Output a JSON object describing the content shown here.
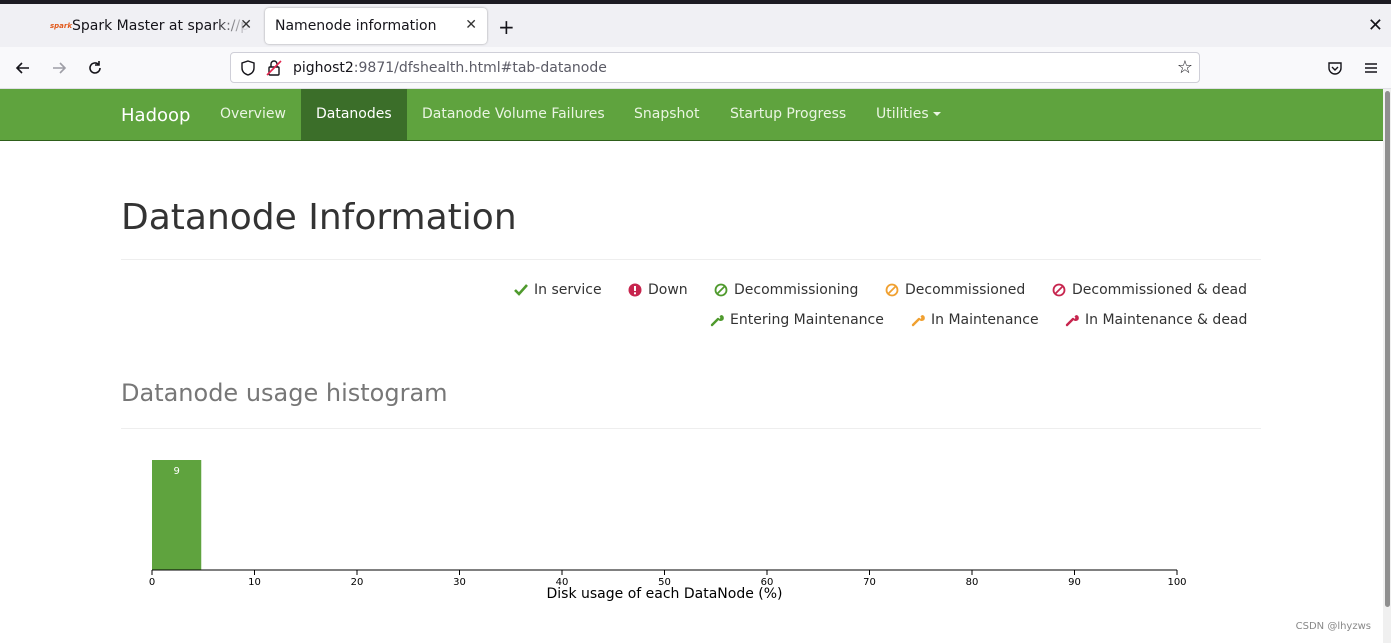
{
  "browser": {
    "tabs": [
      {
        "label": "Spark Master at spark://pi",
        "favicon": "spark-favicon",
        "active": false
      },
      {
        "label": "Namenode information",
        "active": true
      }
    ],
    "url_host": "pighost2",
    "url_path": ":9871/dfshealth.html#tab-datanode"
  },
  "nav": {
    "brand": "Hadoop",
    "items": [
      "Overview",
      "Datanodes",
      "Datanode Volume Failures",
      "Snapshot",
      "Startup Progress",
      "Utilities"
    ],
    "active_index": 1
  },
  "page": {
    "title": "Datanode Information",
    "histogram_title": "Datanode usage histogram",
    "watermark": "CSDN @lhyzws"
  },
  "legend": [
    {
      "label": "In service",
      "icon": "check-icon",
      "color": "#4f9a2d"
    },
    {
      "label": "Down",
      "icon": "exclamation-circle-icon",
      "color": "#c7254e"
    },
    {
      "label": "Decommissioning",
      "icon": "ban-icon",
      "color": "#4f9a2d"
    },
    {
      "label": "Decommissioned",
      "icon": "ban-icon",
      "color": "#f0a030"
    },
    {
      "label": "Decommissioned & dead",
      "icon": "ban-icon",
      "color": "#c7254e"
    },
    {
      "label": "Entering Maintenance",
      "icon": "wrench-icon",
      "color": "#4f9a2d"
    },
    {
      "label": "In Maintenance",
      "icon": "wrench-icon",
      "color": "#f0a030"
    },
    {
      "label": "In Maintenance & dead",
      "icon": "wrench-icon",
      "color": "#c7254e"
    }
  ],
  "chart_data": {
    "type": "bar",
    "title": "",
    "xlabel": "Disk usage of each DataNode (%)",
    "ylabel": "",
    "xlim": [
      0,
      100
    ],
    "xticks": [
      0,
      10,
      20,
      30,
      40,
      50,
      60,
      70,
      80,
      90,
      100
    ],
    "bins": [
      {
        "x0": 0,
        "x1": 5,
        "value": 9
      }
    ],
    "bar_color": "#5fa33e",
    "grid": false
  }
}
